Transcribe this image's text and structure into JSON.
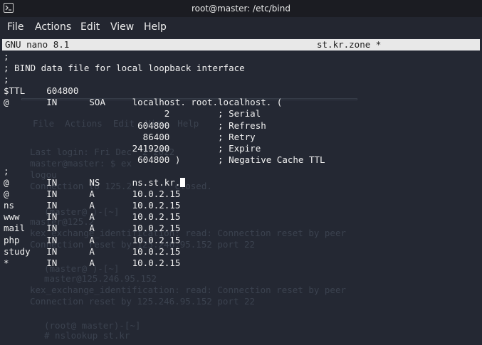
{
  "window": {
    "title": "root@master: /etc/bind"
  },
  "menu": [
    "File",
    "Actions",
    "Edit",
    "View",
    "Help"
  ],
  "nano": {
    "version": "GNU nano 8.1",
    "filename": "st.kr.zone *"
  },
  "file_lines": [
    ";",
    "; BIND data file for local loopback interface",
    ";",
    "$TTL    604800",
    "@       IN      SOA     localhost. root.localhost. (",
    "                              2         ; Serial",
    "                         604800         ; Refresh",
    "                          86400         ; Retry",
    "                        2419200         ; Expire",
    "                         604800 )       ; Negative Cache TTL",
    ";",
    "@       IN      NS      ns.st.kr.",
    "@       IN      A       10.0.2.15",
    "ns      IN      A       10.0.2.15",
    "www     IN      A       10.0.2.15",
    "mail    IN      A       10.0.2.15",
    "php     IN      A       10.0.2.15",
    "study   IN      A       10.0.2.15",
    "*       IN      A       10.0.2.15"
  ],
  "cursor_line": 11,
  "background_ghost": [
    "File  Actions  Edit  View  Help",
    "Last login: Fri Dec  2 2022",
    "master@master: $ ex",
    "logou",
    "Connection to 125.2        closed.",
    "master@125.2",
    "kex_exchange_identification: read: Connection reset by peer",
    "Connection reset by 125.246.95.152 port 22",
    "master@125.246.95.152",
    "kex_exchange_identification: read: Connection reset by peer",
    "Connection reset by 125.246.95.152 port 22",
    "(root@ master)-[~]",
    "# nslookup st.kr",
    "(master@ )-[~]",
    "(master@ )-[~]"
  ]
}
